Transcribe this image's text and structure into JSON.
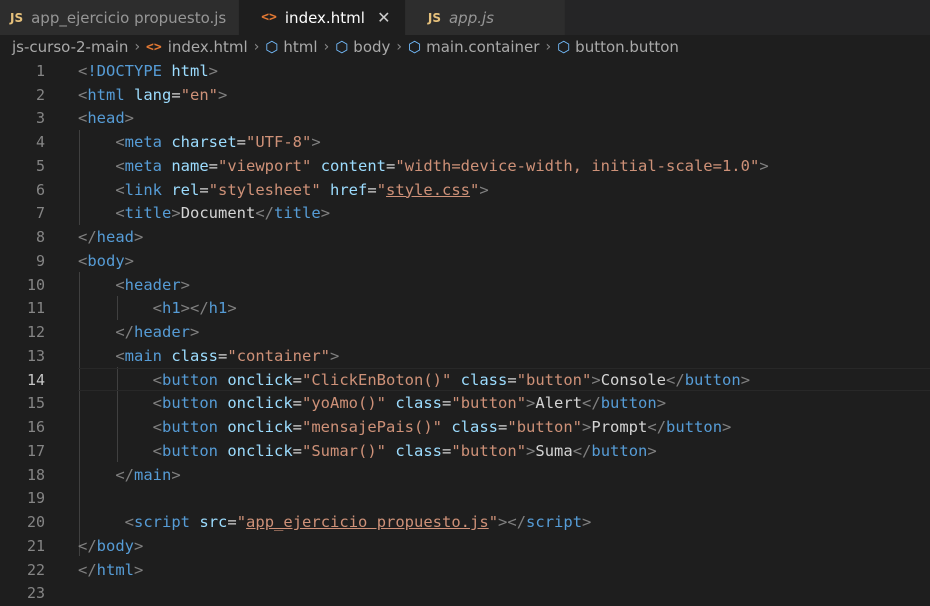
{
  "tabs": [
    {
      "label": "app_ejercicio propuesto.js",
      "badge": "JS",
      "kind": "js",
      "active": false,
      "italic": false
    },
    {
      "label": "index.html",
      "badge": "<>",
      "kind": "html",
      "active": true,
      "italic": false,
      "close": "✕"
    },
    {
      "label": "app.js",
      "badge": "JS",
      "kind": "js",
      "active": false,
      "italic": true
    }
  ],
  "breadcrumb": [
    "js-curso-2-main",
    "index.html",
    "html",
    "body",
    "main.container",
    "button.button"
  ],
  "lines": [
    {
      "n": "1"
    },
    {
      "n": "2"
    },
    {
      "n": "3"
    },
    {
      "n": "4"
    },
    {
      "n": "5"
    },
    {
      "n": "6"
    },
    {
      "n": "7"
    },
    {
      "n": "8"
    },
    {
      "n": "9"
    },
    {
      "n": "10"
    },
    {
      "n": "11"
    },
    {
      "n": "12"
    },
    {
      "n": "13"
    },
    {
      "n": "14"
    },
    {
      "n": "15"
    },
    {
      "n": "16"
    },
    {
      "n": "17"
    },
    {
      "n": "18"
    },
    {
      "n": "19"
    },
    {
      "n": "20"
    },
    {
      "n": "21"
    },
    {
      "n": "22"
    },
    {
      "n": "23"
    }
  ],
  "code": {
    "doctype": "!DOCTYPE",
    "html_word": "html",
    "lang_attr": "lang",
    "lang_val": "\"en\"",
    "head": "head",
    "meta": "meta",
    "charset_attr": "charset",
    "charset_val": "\"UTF-8\"",
    "name_attr": "name",
    "name_val": "\"viewport\"",
    "content_attr": "content",
    "content_val": "\"width=device-width, initial-scale=1.0\"",
    "link": "link",
    "rel_attr": "rel",
    "rel_val": "\"stylesheet\"",
    "href_attr": "href",
    "href_q1": "\"",
    "href_val": "style.css",
    "href_q2": "\"",
    "title": "title",
    "title_text": "Document",
    "body": "body",
    "header": "header",
    "h1": "h1",
    "main": "main",
    "class_attr": "class",
    "container_val": "\"container\"",
    "button": "button",
    "onclick_attr": "onclick",
    "b1_onclick": "\"ClickEnBoton()\"",
    "b1_text": "Console",
    "b2_onclick": "\"yoAmo()\"",
    "b2_text": "Alert",
    "b3_onclick": "\"mensajePais()\"",
    "b3_text": "Prompt",
    "b4_onclick": "\"Sumar()\"",
    "b4_text": "Suma",
    "button_class_val": "\"button\"",
    "script": "script",
    "src_attr": "src",
    "src_q1": "\"",
    "src_val": "app_ejercicio propuesto.js",
    "src_q2": "\""
  }
}
